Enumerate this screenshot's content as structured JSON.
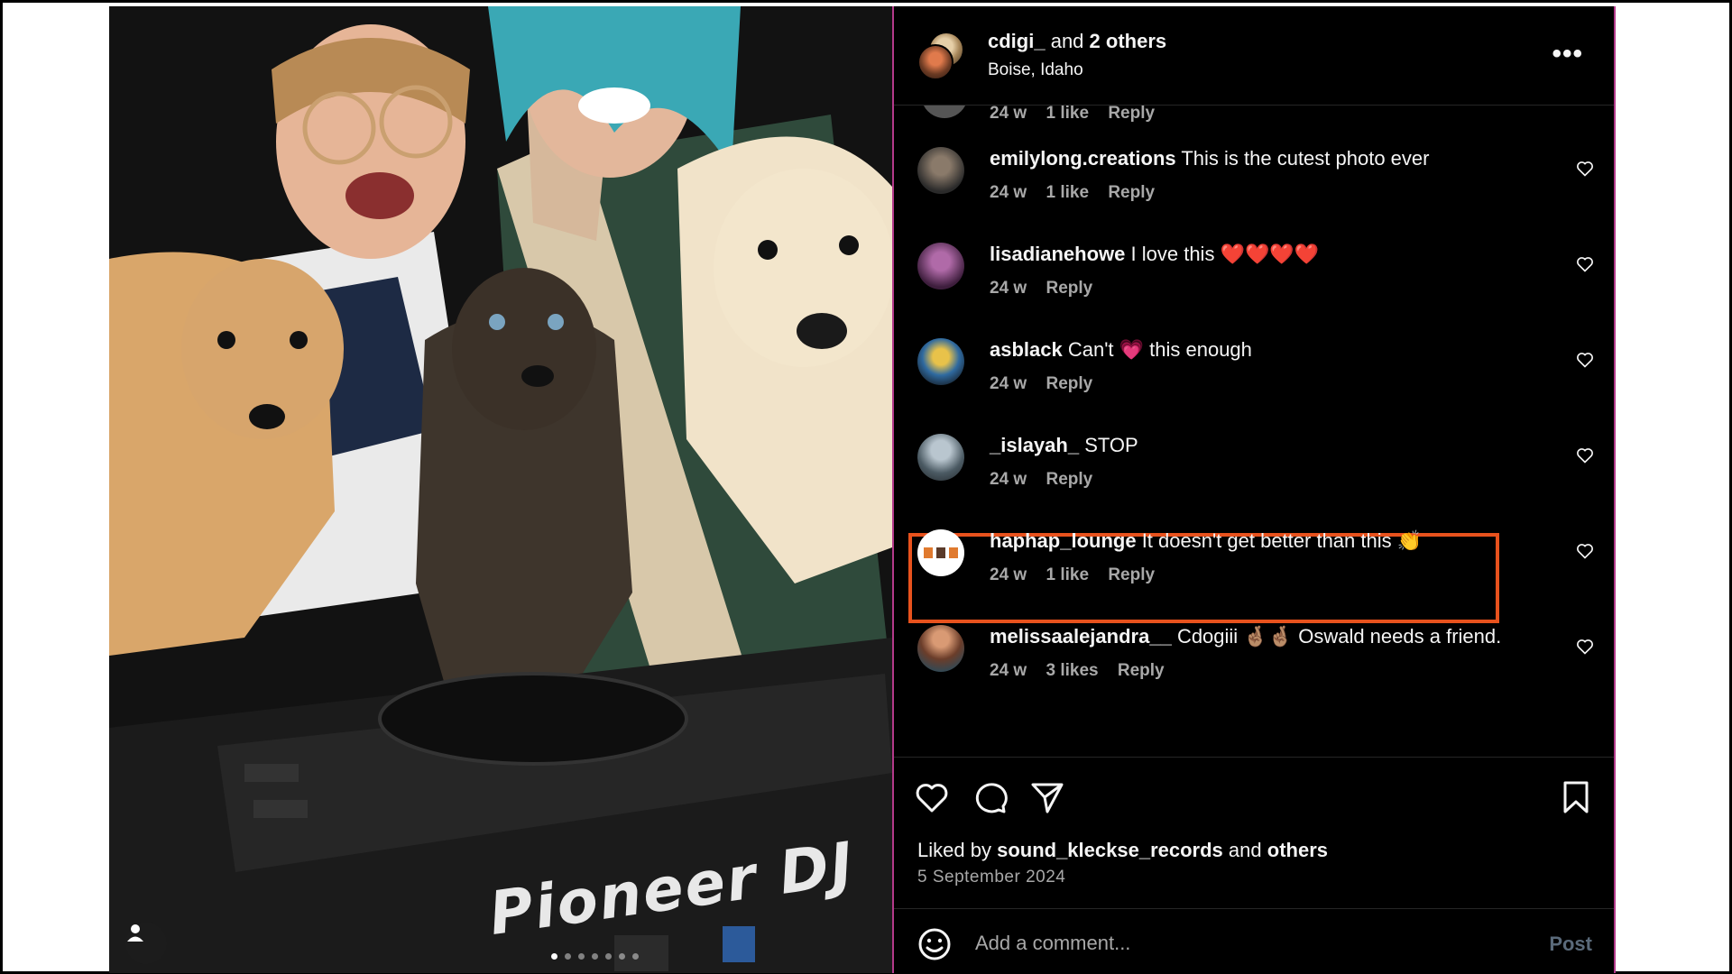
{
  "post": {
    "brand_text": "Pioneer DJ",
    "carousel": {
      "count": 7,
      "active_index": 0
    },
    "header": {
      "author": "cdigi_",
      "coauthors_connector": "and",
      "coauthors": "2 others",
      "location": "Boise, Idaho",
      "more_label": "..."
    },
    "partial_comment": {
      "time": "24 w",
      "likes": "1 like",
      "reply": "Reply"
    },
    "comments": [
      {
        "user": "emilylong.creations",
        "text": "This is the cutest photo ever",
        "time": "24 w",
        "likes": "1 like",
        "reply": "Reply",
        "avatar_color": "#3b3b3b"
      },
      {
        "user": "lisadianehowe",
        "text": "I love this ❤️❤️❤️❤️",
        "time": "24 w",
        "likes": "",
        "reply": "Reply",
        "avatar_color": "#5a2c5e"
      },
      {
        "user": "asblack",
        "text": "Can't 💗 this enough",
        "time": "24 w",
        "likes": "",
        "reply": "Reply",
        "avatar_color": "#c79a2b"
      },
      {
        "user": "_islayah_",
        "text": "STOP",
        "time": "24 w",
        "likes": "",
        "reply": "Reply",
        "avatar_color": "#7d8b96"
      },
      {
        "user": "haphap_lounge",
        "text": "It doesn't get better than this 👏",
        "time": "24 w",
        "likes": "1 like",
        "reply": "Reply",
        "avatar_color": "#ffffff"
      },
      {
        "user": "melissaalejandra__",
        "text": "Cdogiii 🤞🏽🤞🏽 Oswald needs a friend.",
        "time": "24 w",
        "likes": "3 likes",
        "reply": "Reply",
        "avatar_color": "#8a5a3e"
      }
    ],
    "liked_by": {
      "prefix": "Liked by",
      "user": "sound_kleckse_records",
      "connector": "and",
      "others": "others"
    },
    "date": "5 September 2024",
    "add_comment": {
      "placeholder": "Add a comment...",
      "post_label": "Post"
    },
    "colors": {
      "highlight": "#e8521d",
      "panel_bg": "#000000",
      "muted_text": "#a8a8a8",
      "panel_border": "#b33a8a"
    }
  }
}
